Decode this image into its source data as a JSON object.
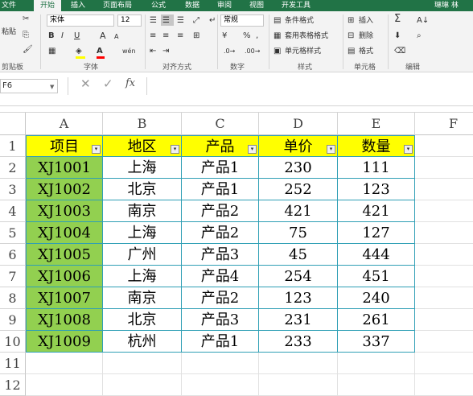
{
  "ribbon_tabs": [
    "文件",
    "开始",
    "插入",
    "页面布局",
    "公式",
    "数据",
    "审阅",
    "视图",
    "开发工具"
  ],
  "user_name": "琳琳 林",
  "clipboard": {
    "paste_label": "粘贴",
    "group_label": "剪贴板"
  },
  "font": {
    "name": "宋体",
    "size": "12",
    "group_label": "字体",
    "bold": "B",
    "italic": "I",
    "underline": "U",
    "grow": "A",
    "shrink": "A",
    "fill_color": "#ffff00",
    "font_color": "#ff0000",
    "phonetic": "wén"
  },
  "alignment": {
    "group_label": "对齐方式"
  },
  "number": {
    "format": "常规",
    "group_label": "数字",
    "percent": "%",
    "comma": ","
  },
  "styles": {
    "conditional": "条件格式",
    "table": "套用表格格式",
    "cell": "单元格样式",
    "group_label": "样式"
  },
  "cells": {
    "insert": "插入",
    "delete": "删除",
    "format": "格式",
    "group_label": "单元格"
  },
  "editing": {
    "group_label": "编辑"
  },
  "formula_bar": {
    "name_box": "F6",
    "fx": "fx",
    "formula": ""
  },
  "columns": [
    "A",
    "B",
    "C",
    "D",
    "E",
    "F"
  ],
  "rows": [
    "1",
    "2",
    "3",
    "4",
    "5",
    "6",
    "7",
    "8",
    "9",
    "10",
    "11",
    "12"
  ],
  "table": {
    "headers": [
      "项目",
      "地区",
      "产品",
      "单价",
      "数量"
    ],
    "rows": [
      [
        "XJ1001",
        "上海",
        "产品1",
        "230",
        "111"
      ],
      [
        "XJ1002",
        "北京",
        "产品1",
        "252",
        "123"
      ],
      [
        "XJ1003",
        "南京",
        "产品2",
        "421",
        "421"
      ],
      [
        "XJ1004",
        "上海",
        "产品2",
        "75",
        "127"
      ],
      [
        "XJ1005",
        "广州",
        "产品3",
        "45",
        "444"
      ],
      [
        "XJ1006",
        "上海",
        "产品4",
        "254",
        "451"
      ],
      [
        "XJ1007",
        "南京",
        "产品2",
        "123",
        "240"
      ],
      [
        "XJ1008",
        "北京",
        "产品3",
        "231",
        "261"
      ],
      [
        "XJ1009",
        "杭州",
        "产品1",
        "233",
        "337"
      ]
    ]
  },
  "colors": {
    "header_fill": "#ffff00",
    "id_fill": "#92d050",
    "border": "#2f9fb5",
    "tab_bar": "#217346"
  }
}
